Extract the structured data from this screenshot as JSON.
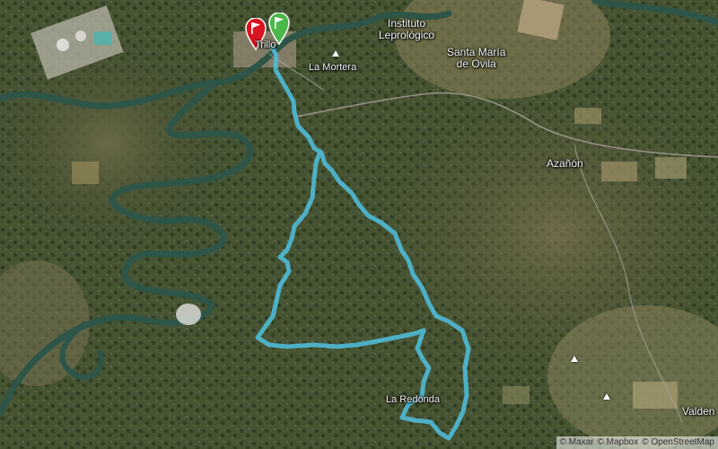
{
  "map": {
    "places": [
      {
        "id": "trillo",
        "text": "Trillo"
      },
      {
        "id": "la-mortera",
        "text": "La Mortera"
      },
      {
        "id": "instituto",
        "text": "Instituto\nLeprológico"
      },
      {
        "id": "santa-maria",
        "text": "Santa María\nde Ovila"
      },
      {
        "id": "azanon",
        "text": "Azañón"
      },
      {
        "id": "la-redonda",
        "text": "La Redonda"
      },
      {
        "id": "valdelagua",
        "text": "Valden"
      }
    ],
    "markers": {
      "start": "start-flag",
      "end": "finish-flag"
    },
    "route_color": "#4fb8d4",
    "start_flag_color": "#4ab84a",
    "end_flag_color": "#d9141e"
  },
  "attribution": {
    "mapbox_satellite": "© Maxar",
    "mapbox": "© Mapbox",
    "osm": "© OpenStreetMap"
  }
}
